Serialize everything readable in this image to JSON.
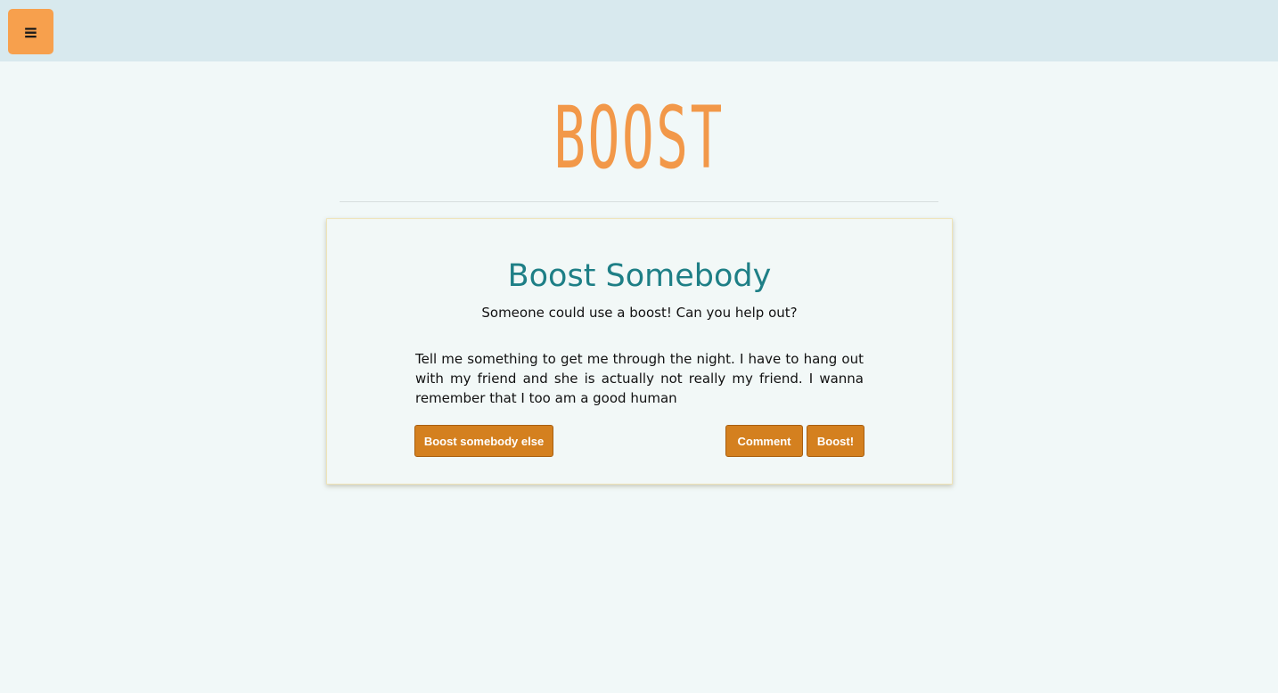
{
  "header": {
    "menu_icon": "≡"
  },
  "logo": {
    "text": "BOOST"
  },
  "card": {
    "title": "Boost Somebody",
    "subtitle": "Someone could use a boost! Can you help out?",
    "message": "Tell me something to get me through the night. I have to hang out with my friend and she is actually not really my friend. I wanna remember that I too am a good human",
    "buttons": {
      "boost_else": "Boost somebody else",
      "comment": "Comment",
      "boost": "Boost!"
    }
  },
  "colors": {
    "accent": "#f29849",
    "button": "#d4801f",
    "title": "#1e7f86",
    "topbar": "#d8e9ee",
    "background": "#f1f8f8"
  }
}
